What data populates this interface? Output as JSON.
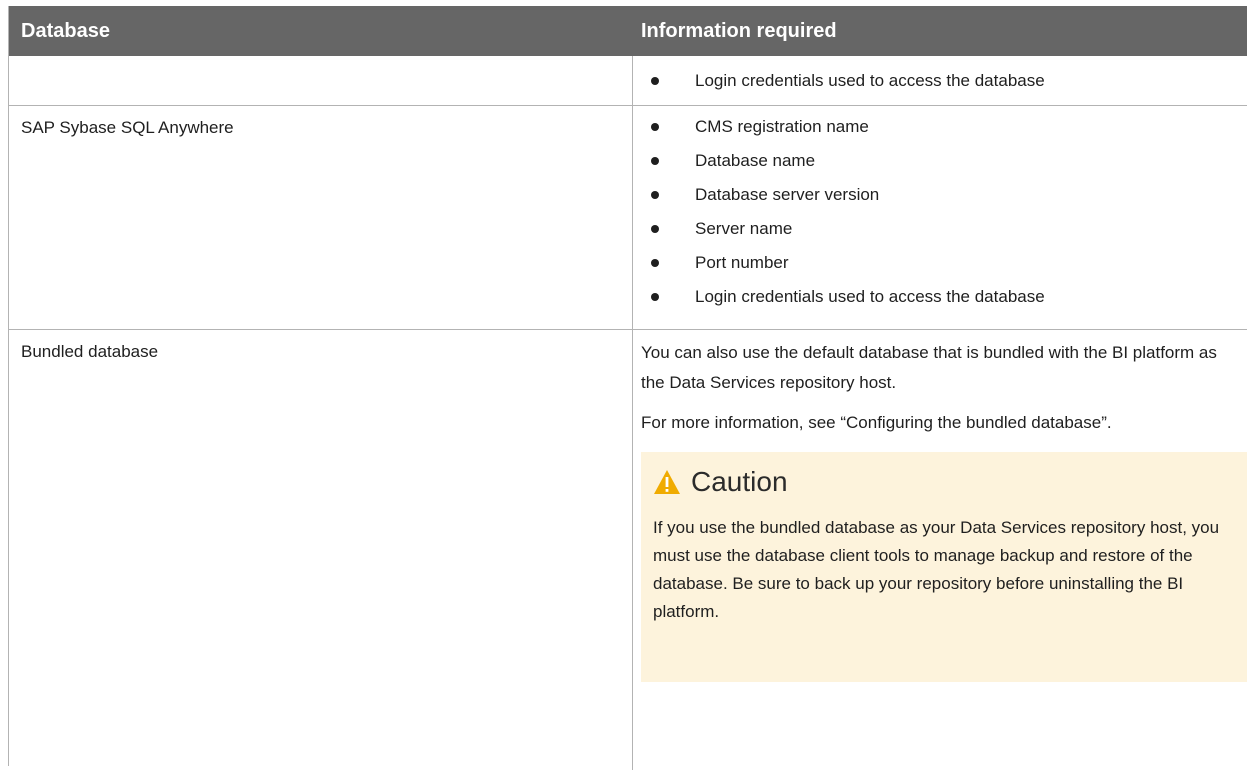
{
  "table": {
    "headers": [
      "Database",
      "Information required"
    ],
    "rows": [
      {
        "database": "",
        "bullets": [
          "Login credentials used to access the database"
        ]
      },
      {
        "database": "SAP Sybase SQL Anywhere",
        "bullets": [
          "CMS registration name",
          "Database name",
          "Database server version",
          "Server name",
          "Port number",
          "Login credentials used to access the database"
        ]
      },
      {
        "database": "Bundled database",
        "paragraphs": [
          "You can also use the default database that is bundled with the BI platform as the Data Services repository host.",
          "For more information, see “Configuring the bundled database”."
        ],
        "caution": {
          "title": "Caution",
          "icon": "warning-icon",
          "text": "If you use the bundled database as your Data Services repository host, you must use the database client tools to manage backup and restore of the database. Be sure to back up your repository before uninstalling the BI platform."
        }
      }
    ]
  },
  "colors": {
    "header_bg": "#666666",
    "caution_bg": "#fdf3dc",
    "warning_icon": "#f0ab00"
  }
}
